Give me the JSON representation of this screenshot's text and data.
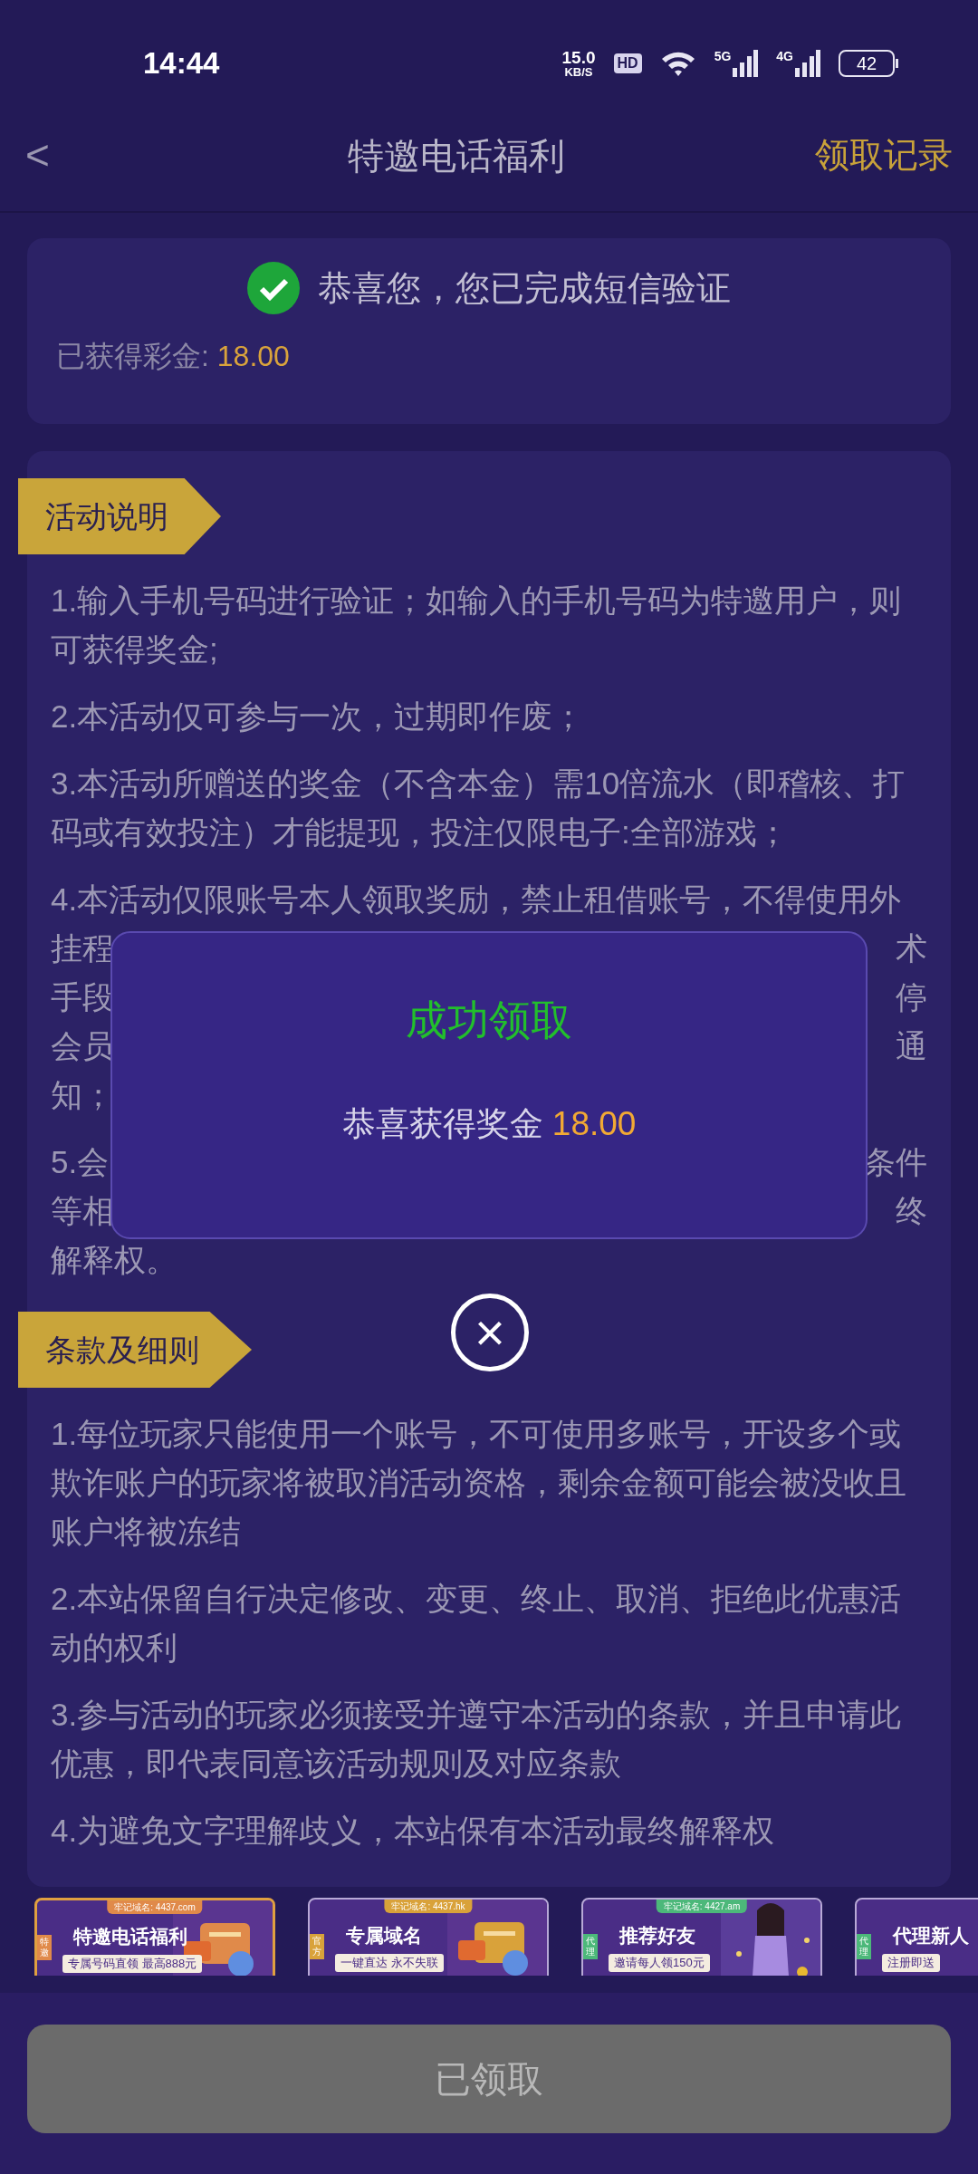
{
  "status_bar": {
    "time": "14:44",
    "speed_value": "15.0",
    "speed_unit": "KB/S",
    "hd": "HD",
    "net1": "5G",
    "net2": "4G",
    "battery": "42"
  },
  "header": {
    "back": "<",
    "title": "特邀电话福利",
    "action": "领取记录"
  },
  "verify_card": {
    "message": "恭喜您，您已完成短信验证",
    "bonus_label": "已获得彩金:",
    "bonus_value": "18.00"
  },
  "activity": {
    "tag": "活动说明",
    "items": [
      {
        "kind": "text",
        "text": "1.输入手机号码进行验证；如输入的手机号码为特邀用户，则可获得奖金;"
      },
      {
        "kind": "text",
        "text": "2.本活动仅可参与一次，过期即作废；"
      },
      {
        "kind": "text",
        "text": "3.本活动所赠送的奖金（不含本金）需10倍流水（即稽核、打码或有效投注）才能提现，投注仅限电子:全部游戏；"
      },
      {
        "kind": "covered",
        "lines": [
          {
            "left": "4.本活动仅限账号本人领取奖励，禁止租借账号，不得使用外"
          },
          {
            "left": "挂程",
            "right": "术"
          },
          {
            "left": "手段",
            "right": "停"
          },
          {
            "left": "会员",
            "right": "通"
          },
          {
            "left": "知；"
          }
        ]
      },
      {
        "kind": "covered",
        "lines": [
          {
            "left": "5.会",
            "right": "条件"
          },
          {
            "left": "等相",
            "right": "终"
          },
          {
            "left": "解释权。"
          }
        ]
      }
    ]
  },
  "terms": {
    "tag": "条款及细则",
    "items": [
      "1.每位玩家只能使用一个账号，不可使用多账号，开设多个或欺诈账户的玩家将被取消活动资格，剩余金额可能会被没收且账户将被冻结",
      "2.本站保留自行决定修改、变更、终止、取消、拒绝此优惠活动的权利",
      "3.参与活动的玩家必须接受并遵守本活动的条款，并且申请此优惠，即代表同意该活动规则及对应条款",
      "4.为避免文字理解歧义，本站保有本活动最终解释权"
    ]
  },
  "banners": [
    {
      "domain": "牢记域名: 4437.com",
      "tag": "特邀",
      "title": "特邀电话福利",
      "subtitle": "专属号码直领 最高888元",
      "selected": true,
      "color": "#e08a4a"
    },
    {
      "domain": "牢记域名: 4437.hk",
      "tag": "官方",
      "title": "专属域名",
      "subtitle": "一键直达 永不失联",
      "selected": false,
      "color": "#d9a23a"
    },
    {
      "domain": "牢记域名: 4427.am",
      "tag": "代理",
      "title": "推荐好友",
      "subtitle": "邀请每人领150元",
      "selected": false,
      "color": "#4cb87a"
    },
    {
      "tag": "代理",
      "title": "代理新人",
      "subtitle": "注册即送",
      "selected": false,
      "color": "#4cb87a"
    }
  ],
  "dialog": {
    "title": "成功领取",
    "message": "恭喜获得奖金",
    "amount": "18.00",
    "close": "×"
  },
  "bottom_button": {
    "label": "已领取",
    "disabled": true
  }
}
